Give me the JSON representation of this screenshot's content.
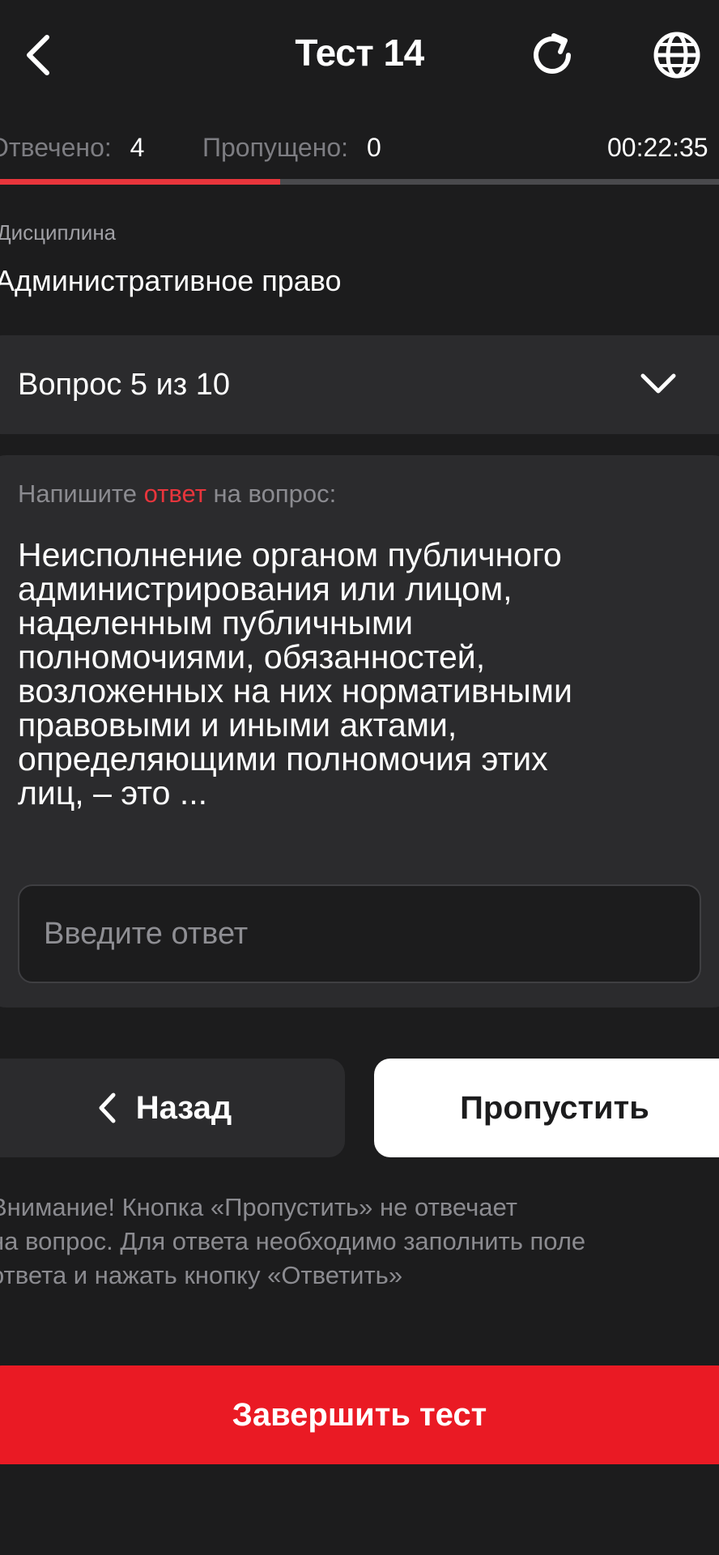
{
  "header": {
    "title": "Тест 14",
    "back_icon": "chevron-left-icon",
    "refresh_icon": "refresh-icon",
    "language_icon": "globe-icon"
  },
  "status": {
    "answered_label": "Отвечено:",
    "answered_value": "4",
    "skipped_label": "Пропущено:",
    "skipped_value": "0",
    "timer": "00:22:35"
  },
  "progress": {
    "fraction": 0.39,
    "fill_color": "#e8353c",
    "track_color": "#4a4a4d"
  },
  "discipline": {
    "label": "Дисциплина",
    "value": "Административное право"
  },
  "question_selector": {
    "label": "Вопрос 5 из 10",
    "icon": "chevron-down-icon"
  },
  "question": {
    "prompt_before": "Напишите ",
    "prompt_accent": "ответ",
    "prompt_after": " на вопрос:",
    "lines": [
      "Неисполнение органом публичного",
      "администрирования или лицом,",
      "наделенным публичными",
      "полномочиями, обязанностей,",
      "возложенных на них нормативными",
      "правовыми и иными актами,",
      "определяющими полномочия этих",
      "лиц, – это ..."
    ],
    "answer_value": "",
    "answer_placeholder": "Введите ответ"
  },
  "actions": {
    "back_label": "Назад",
    "skip_label": "Пропустить",
    "finish_label": "Завершить тест"
  },
  "warning": {
    "lines": [
      "Внимание! Кнопка «Пропустить» не отвечает",
      "на вопрос. Для ответа необходимо заполнить поле",
      "ответа и нажать кнопку «Ответить»"
    ]
  },
  "colors": {
    "background": "#1c1c1d",
    "card": "#2b2b2d",
    "accent": "#e8353c",
    "finish": "#ea1a24"
  }
}
